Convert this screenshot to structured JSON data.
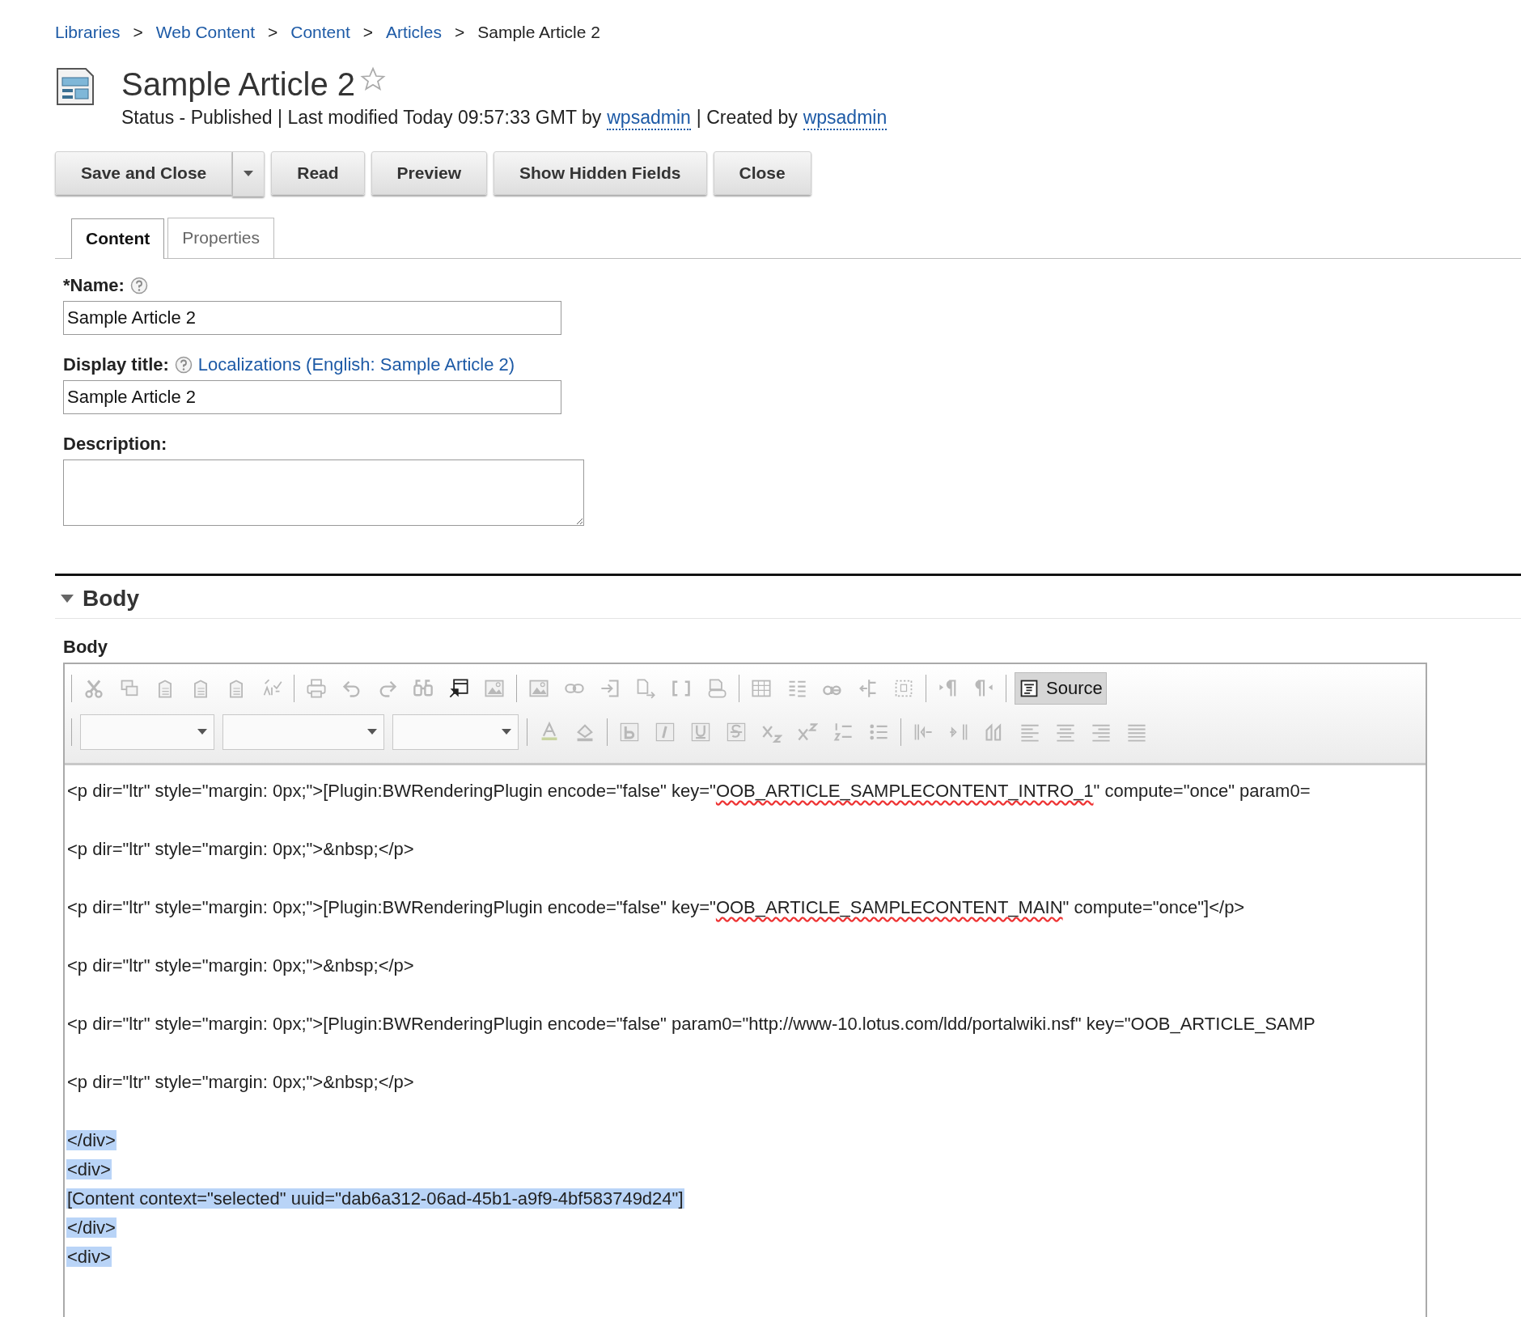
{
  "breadcrumb": [
    {
      "label": "Libraries",
      "link": true
    },
    {
      "label": "Web Content",
      "link": true
    },
    {
      "label": "Content",
      "link": true
    },
    {
      "label": "Articles",
      "link": true
    },
    {
      "label": "Sample Article 2",
      "link": false
    }
  ],
  "breadcrumb_separator": ">",
  "header": {
    "title": "Sample Article 2",
    "favorite": false,
    "status_parts": [
      {
        "text": "Status - Published | Last modified Today 09:57:33 GMT by",
        "link": false
      },
      {
        "text": "wpsadmin",
        "link": true
      },
      {
        "text": "| Created by",
        "link": false
      },
      {
        "text": "wpsadmin",
        "link": true
      }
    ]
  },
  "actions": [
    {
      "label": "Save and Close",
      "has_menu": true
    },
    {
      "label": "Read",
      "has_menu": false
    },
    {
      "label": "Preview",
      "has_menu": false
    },
    {
      "label": "Show Hidden Fields",
      "has_menu": false
    },
    {
      "label": "Close",
      "has_menu": false
    }
  ],
  "tabs": [
    {
      "label": "Content",
      "selected": true
    },
    {
      "label": "Properties",
      "selected": false
    }
  ],
  "fields": [
    {
      "kind": "input",
      "label": "*Name:",
      "help": true,
      "value": "Sample Article 2"
    },
    {
      "kind": "input",
      "label": "Display title:",
      "help": true,
      "link": "Localizations (English: Sample Article 2)",
      "value": "Sample Article 2"
    },
    {
      "kind": "textarea",
      "label": "Description:",
      "help": false
    }
  ],
  "section": {
    "title": "Body",
    "expanded": true
  },
  "editor": {
    "label": "Body",
    "source_button": {
      "label": "Source",
      "selected": true
    },
    "lines": [
      {
        "selected": false,
        "segments": [
          {
            "text": "<p dir=\"ltr\" style=\"margin: 0px;\">[Plugin:BWRenderingPlugin encode=\"false\" key=\"",
            "misspelled": false
          },
          {
            "text": "OOB_ARTICLE_SAMPLECONTENT_INTRO_1",
            "misspelled": true
          },
          {
            "text": "\" compute=\"once\" param0=",
            "misspelled": false
          }
        ]
      },
      {
        "selected": false,
        "segments": [
          {
            "text": "<p dir=\"ltr\" style=\"margin: 0px;\">&nbsp;</p>",
            "misspelled": false
          }
        ]
      },
      {
        "selected": false,
        "segments": [
          {
            "text": "<p dir=\"ltr\" style=\"margin: 0px;\">[Plugin:BWRenderingPlugin encode=\"false\" key=\"",
            "misspelled": false
          },
          {
            "text": "OOB_ARTICLE_SAMPLECONTENT_MAIN",
            "misspelled": true
          },
          {
            "text": "\" compute=\"once\"]</p>",
            "misspelled": false
          }
        ]
      },
      {
        "selected": false,
        "segments": [
          {
            "text": "<p dir=\"ltr\" style=\"margin: 0px;\">&nbsp;</p>",
            "misspelled": false
          }
        ]
      },
      {
        "selected": false,
        "segments": [
          {
            "text": "<p dir=\"ltr\" style=\"margin: 0px;\">[Plugin:BWRenderingPlugin encode=\"false\" param0=\"http://www-10.lotus.com/ldd/portalwiki.nsf\" key=\"OOB_ARTICLE_SAMP",
            "misspelled": false
          }
        ]
      },
      {
        "selected": false,
        "segments": [
          {
            "text": "<p dir=\"ltr\" style=\"margin: 0px;\">&nbsp;</p>",
            "misspelled": false
          }
        ]
      },
      {
        "selected": true,
        "segments": [
          {
            "text": "</div>",
            "misspelled": false
          }
        ]
      },
      {
        "selected": true,
        "segments": [
          {
            "text": "<div>",
            "misspelled": false
          }
        ]
      },
      {
        "selected": true,
        "segments": [
          {
            "text": "[Content context=\"selected\" uuid=\"dab6a312-06ad-45b1-a9f9-4bf583749d24\"]",
            "misspelled": false
          }
        ]
      },
      {
        "selected": true,
        "segments": [
          {
            "text": "</div>",
            "misspelled": false
          }
        ]
      },
      {
        "selected": true,
        "segments": [
          {
            "text": "<div>",
            "misspelled": false
          }
        ]
      }
    ]
  }
}
